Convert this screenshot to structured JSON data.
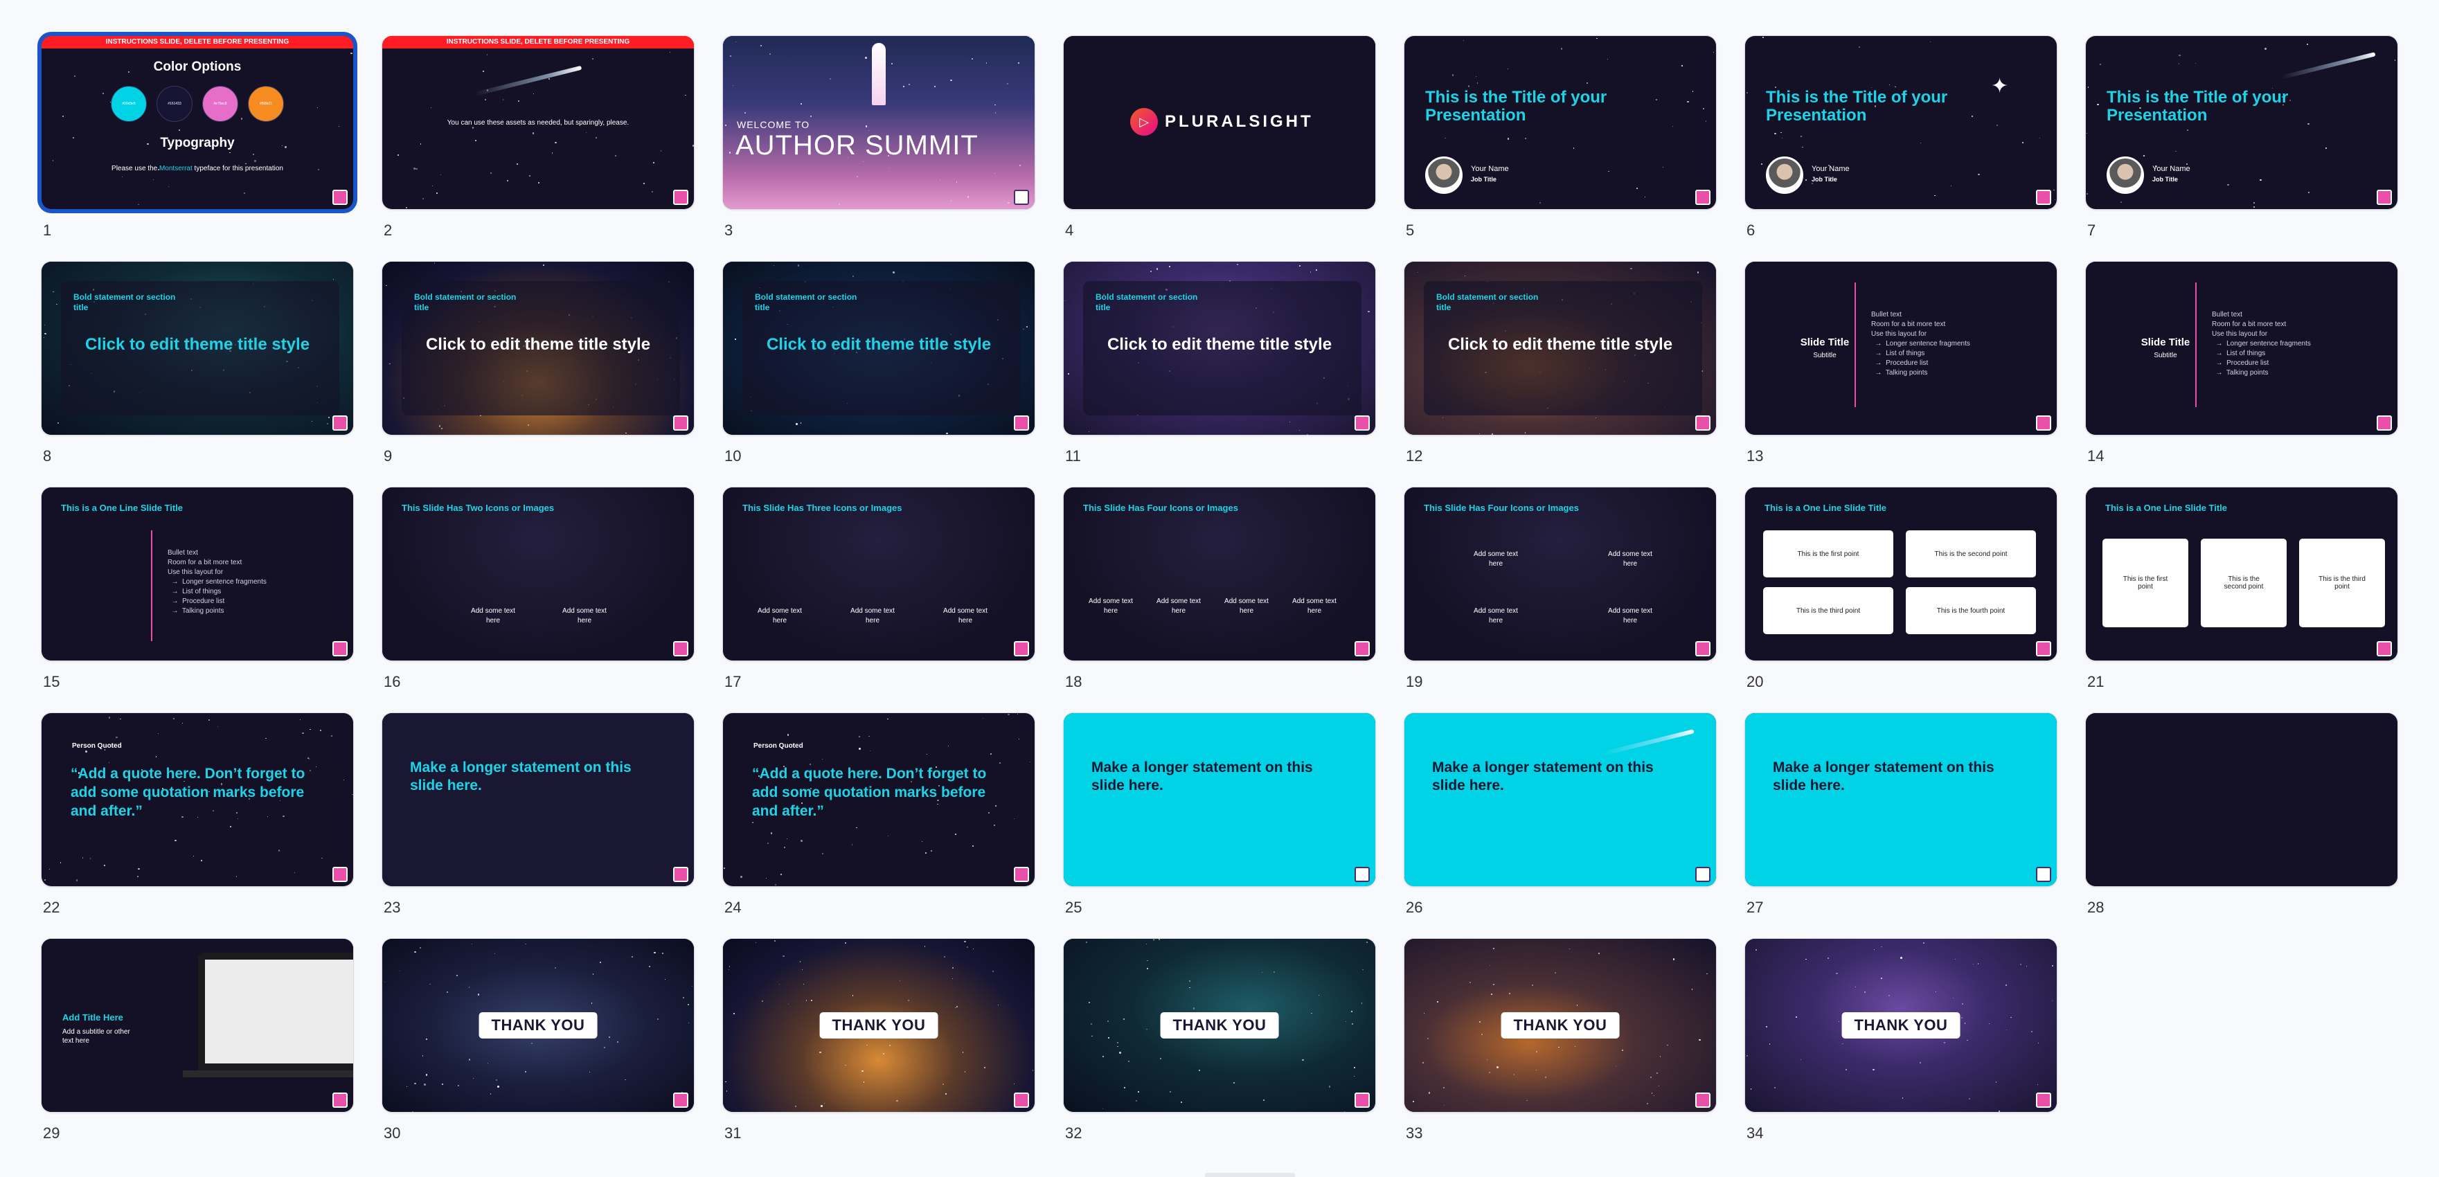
{
  "slides": [
    {
      "n": "1",
      "type": "instructions",
      "bar": "INSTRUCTIONS SLIDE, DELETE BEFORE PRESENTING",
      "title": "Color Options",
      "swatches": [
        {
          "hex": "#00D3E5",
          "label": "#00d3e5"
        },
        {
          "hex": "#161433",
          "label": "#161433"
        },
        {
          "hex": "#E76EC8",
          "label": "#e76ec8"
        },
        {
          "hex": "#F58B21",
          "label": "#f58b21"
        }
      ],
      "subtitle": "Typography",
      "note_pre": "Please use the ",
      "note_font": "Montserrat",
      "note_post": " typeface for this presentation"
    },
    {
      "n": "2",
      "type": "assets",
      "bar": "INSTRUCTIONS SLIDE, DELETE BEFORE PRESENTING",
      "text": "You can use these assets as needed, but sparingly, please."
    },
    {
      "n": "3",
      "type": "author",
      "small": "WELCOME TO",
      "big": "AUTHOR SUMMIT"
    },
    {
      "n": "4",
      "type": "pluralsight",
      "brand": "PLURALSIGHT"
    },
    {
      "n": "5",
      "type": "titlename",
      "title": "This is the Title of your Presentation",
      "name": "Your Name",
      "job": "Job Title"
    },
    {
      "n": "6",
      "type": "titlename",
      "title": "This is the Title of your Presentation",
      "name": "Your Name",
      "job": "Job Title"
    },
    {
      "n": "7",
      "type": "titlename",
      "title": "This is the Title of your Presentation",
      "name": "Your Name",
      "job": "Job Title"
    },
    {
      "n": "8",
      "type": "section",
      "bg": "teal",
      "kicker": "Bold statement or section title",
      "title": "Click to edit theme title style",
      "titleColor": "cyan"
    },
    {
      "n": "9",
      "type": "section",
      "bg": "orange",
      "kicker": "Bold statement or section title",
      "title": "Click to edit theme title style",
      "titleColor": "white"
    },
    {
      "n": "10",
      "type": "section",
      "bg": "blue",
      "kicker": "Bold statement or section title",
      "title": "Click to edit theme title style",
      "titleColor": "cyan"
    },
    {
      "n": "11",
      "type": "section",
      "bg": "purple",
      "kicker": "Bold statement or section title",
      "title": "Click to edit theme title style",
      "titleColor": "white"
    },
    {
      "n": "12",
      "type": "section",
      "bg": "gold",
      "kicker": "Bold statement or section title",
      "title": "Click to edit theme title style",
      "titleColor": "white"
    },
    {
      "n": "13",
      "type": "bullets-side",
      "title": "Slide Title",
      "subtitle": "Subtitle",
      "bullets": "Bullet text\nRoom for a bit more text\nUse this layout for\n  →  Longer sentence fragments\n  →  List of things\n  →  Procedure list\n  →  Talking points"
    },
    {
      "n": "14",
      "type": "bullets-side",
      "title": "Slide Title",
      "subtitle": "Subtitle",
      "bullets": "Bullet text\nRoom for a bit more text\nUse this layout for\n  →  Longer sentence fragments\n  →  List of things\n  →  Procedure list\n  →  Talking points"
    },
    {
      "n": "15",
      "type": "oneline-bullets",
      "title": "This is a One Line Slide Title",
      "bullets": "Bullet text\nRoom for a bit more text\nUse this layout for\n  →  Longer sentence fragments\n  →  List of things\n  →  Procedure list\n  →  Talking points"
    },
    {
      "n": "16",
      "type": "icons",
      "title": "This Slide Has Two Icons or Images",
      "items": [
        "Add some text here",
        "Add some text here"
      ]
    },
    {
      "n": "17",
      "type": "icons",
      "title": "This Slide Has Three Icons or Images",
      "items": [
        "Add some text here",
        "Add some text here",
        "Add some text here"
      ]
    },
    {
      "n": "18",
      "type": "icons",
      "title": "This Slide Has Four Icons or Images",
      "items": [
        "Add some text here",
        "Add some text here",
        "Add some text here",
        "Add some text here"
      ]
    },
    {
      "n": "19",
      "type": "icons-grid",
      "title": "This Slide Has Four Icons or Images",
      "items": [
        "Add some text here",
        "Add some text here",
        "Add some text here",
        "Add some text here"
      ]
    },
    {
      "n": "20",
      "type": "points4",
      "title": "This is a One Line Slide Title",
      "items": [
        "This is the first point",
        "This is the second point",
        "This is the third point",
        "This is the fourth point"
      ]
    },
    {
      "n": "21",
      "type": "points3",
      "title": "This is a One Line Slide Title",
      "items": [
        "This is the first point",
        "This is the second point",
        "This is the third point"
      ]
    },
    {
      "n": "22",
      "type": "quote",
      "person": "Person Quoted",
      "quote": "“Add a quote here. Don’t forget to add some quotation marks before and after.”"
    },
    {
      "n": "23",
      "type": "statement",
      "text": "Make a longer statement on this slide here.",
      "theme": "dark"
    },
    {
      "n": "24",
      "type": "quote",
      "person": "Person Quoted",
      "quote": "“Add a quote here. Don’t forget to add some quotation marks before and after.”"
    },
    {
      "n": "25",
      "type": "statement",
      "text": "Make a longer statement on this slide here.",
      "theme": "cyan"
    },
    {
      "n": "26",
      "type": "statement",
      "text": "Make a longer statement on this slide here.",
      "theme": "cyan"
    },
    {
      "n": "27",
      "type": "statement",
      "text": "Make a longer statement on this slide here.",
      "theme": "cyan"
    },
    {
      "n": "28",
      "type": "blank"
    },
    {
      "n": "29",
      "type": "laptop",
      "title": "Add Title Here",
      "subtitle": "Add a subtitle or other text here"
    },
    {
      "n": "30",
      "type": "thanks",
      "bg": "space",
      "label": "THANK YOU"
    },
    {
      "n": "31",
      "type": "thanks",
      "bg": "orange",
      "label": "THANK YOU"
    },
    {
      "n": "32",
      "type": "thanks",
      "bg": "teal",
      "label": "THANK YOU"
    },
    {
      "n": "33",
      "type": "thanks",
      "bg": "gold",
      "label": "THANK YOU"
    },
    {
      "n": "34",
      "type": "thanks",
      "bg": "purple",
      "label": "THANK YOU"
    }
  ],
  "colors": {
    "accent": "#1fd3e6",
    "selection": "#1a56c9",
    "pink": "#e84fa8",
    "navy": "#141126"
  },
  "selected_slide": "1"
}
